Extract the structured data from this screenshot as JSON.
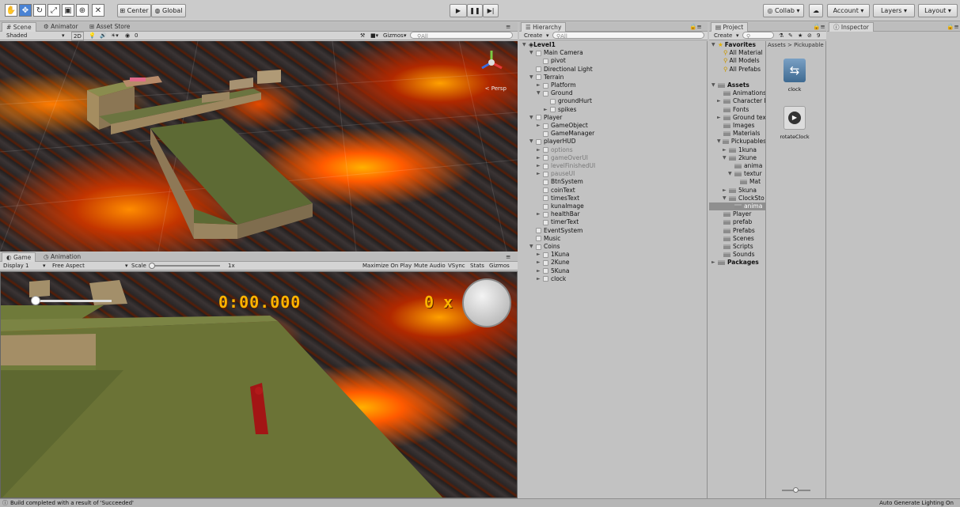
{
  "toolbar": {
    "center_label": "Center",
    "global_label": "Global",
    "collab_label": "Collab",
    "account_label": "Account",
    "layers_label": "Layers",
    "layout_label": "Layout"
  },
  "scene": {
    "tabs": [
      "Scene",
      "Animator",
      "Asset Store"
    ],
    "shaded": "Shaded",
    "two_d": "2D",
    "gizmos": "Gizmos",
    "search_placeholder": "All",
    "persp": "< Persp",
    "fx_count": "0"
  },
  "game": {
    "tabs": [
      "Game",
      "Animation"
    ],
    "display": "Display 1",
    "aspect": "Free Aspect",
    "scale_label": "Scale",
    "scale_value": "1x",
    "options": [
      "Maximize On Play",
      "Mute Audio",
      "VSync",
      "Stats",
      "Gizmos"
    ],
    "timer": "0:00.000",
    "coin_count": "0 x"
  },
  "hierarchy": {
    "title": "Hierarchy",
    "create": "Create",
    "search_placeholder": "All",
    "items": [
      {
        "label": "Level1",
        "depth": 0,
        "arrow": "▼",
        "kind": "scene"
      },
      {
        "label": "Main Camera",
        "depth": 1,
        "arrow": "▼",
        "kind": "go"
      },
      {
        "label": "pivot",
        "depth": 2,
        "arrow": "",
        "kind": "go"
      },
      {
        "label": "Directional Light",
        "depth": 1,
        "arrow": "",
        "kind": "go"
      },
      {
        "label": "Terrain",
        "depth": 1,
        "arrow": "▼",
        "kind": "go"
      },
      {
        "label": "Platform",
        "depth": 2,
        "arrow": "►",
        "kind": "go"
      },
      {
        "label": "Ground",
        "depth": 2,
        "arrow": "▼",
        "kind": "go"
      },
      {
        "label": "groundHurt",
        "depth": 3,
        "arrow": "",
        "kind": "go"
      },
      {
        "label": "spikes",
        "depth": 3,
        "arrow": "►",
        "kind": "go"
      },
      {
        "label": "Player",
        "depth": 1,
        "arrow": "▼",
        "kind": "go"
      },
      {
        "label": "GameObject",
        "depth": 2,
        "arrow": "►",
        "kind": "go"
      },
      {
        "label": "GameManager",
        "depth": 2,
        "arrow": "",
        "kind": "go"
      },
      {
        "label": "playerHUD",
        "depth": 1,
        "arrow": "▼",
        "kind": "go"
      },
      {
        "label": "options",
        "depth": 2,
        "arrow": "►",
        "kind": "dim"
      },
      {
        "label": "gameOverUI",
        "depth": 2,
        "arrow": "►",
        "kind": "dim"
      },
      {
        "label": "levelFinishedUI",
        "depth": 2,
        "arrow": "►",
        "kind": "dim"
      },
      {
        "label": "pauseUI",
        "depth": 2,
        "arrow": "►",
        "kind": "dim"
      },
      {
        "label": "BtnSystem",
        "depth": 2,
        "arrow": "",
        "kind": "go"
      },
      {
        "label": "coinText",
        "depth": 2,
        "arrow": "",
        "kind": "go"
      },
      {
        "label": "timesText",
        "depth": 2,
        "arrow": "",
        "kind": "go"
      },
      {
        "label": "kunaImage",
        "depth": 2,
        "arrow": "",
        "kind": "go"
      },
      {
        "label": "healthBar",
        "depth": 2,
        "arrow": "►",
        "kind": "go"
      },
      {
        "label": "timerText",
        "depth": 2,
        "arrow": "",
        "kind": "go"
      },
      {
        "label": "EventSystem",
        "depth": 1,
        "arrow": "",
        "kind": "go"
      },
      {
        "label": "Music",
        "depth": 1,
        "arrow": "",
        "kind": "go"
      },
      {
        "label": "Coins",
        "depth": 1,
        "arrow": "▼",
        "kind": "go"
      },
      {
        "label": "1Kuna",
        "depth": 2,
        "arrow": "►",
        "kind": "go"
      },
      {
        "label": "2Kune",
        "depth": 2,
        "arrow": "►",
        "kind": "go"
      },
      {
        "label": "5Kuna",
        "depth": 2,
        "arrow": "►",
        "kind": "go"
      },
      {
        "label": "clock",
        "depth": 2,
        "arrow": "►",
        "kind": "go"
      }
    ]
  },
  "project": {
    "title": "Project",
    "create": "Create",
    "breadcrumb": "Assets > Pickupable",
    "tree": [
      {
        "label": "Favorites",
        "depth": 0,
        "arrow": "▼",
        "bold": true,
        "kind": "star"
      },
      {
        "label": "All Material",
        "depth": 1,
        "arrow": "",
        "kind": "search"
      },
      {
        "label": "All Models",
        "depth": 1,
        "arrow": "",
        "kind": "search"
      },
      {
        "label": "All Prefabs",
        "depth": 1,
        "arrow": "",
        "kind": "search"
      },
      {
        "label": "",
        "depth": 0,
        "arrow": "",
        "kind": "spacer"
      },
      {
        "label": "Assets",
        "depth": 0,
        "arrow": "▼",
        "bold": true,
        "kind": "folder"
      },
      {
        "label": "Animations",
        "depth": 1,
        "arrow": "",
        "kind": "folder"
      },
      {
        "label": "Character I",
        "depth": 1,
        "arrow": "►",
        "kind": "folder"
      },
      {
        "label": "Fonts",
        "depth": 1,
        "arrow": "",
        "kind": "folder"
      },
      {
        "label": "Ground tex",
        "depth": 1,
        "arrow": "►",
        "kind": "folder"
      },
      {
        "label": "Images",
        "depth": 1,
        "arrow": "",
        "kind": "folder"
      },
      {
        "label": "Materials",
        "depth": 1,
        "arrow": "",
        "kind": "folder"
      },
      {
        "label": "Pickupables",
        "depth": 1,
        "arrow": "▼",
        "kind": "folder"
      },
      {
        "label": "1kuna",
        "depth": 2,
        "arrow": "►",
        "kind": "folder"
      },
      {
        "label": "2kune",
        "depth": 2,
        "arrow": "▼",
        "kind": "folder"
      },
      {
        "label": "anima",
        "depth": 3,
        "arrow": "",
        "kind": "folder"
      },
      {
        "label": "textur",
        "depth": 3,
        "arrow": "▼",
        "kind": "folder"
      },
      {
        "label": "Mat",
        "depth": 4,
        "arrow": "",
        "kind": "folder"
      },
      {
        "label": "5kuna",
        "depth": 2,
        "arrow": "►",
        "kind": "folder"
      },
      {
        "label": "ClockSto",
        "depth": 2,
        "arrow": "▼",
        "kind": "folder"
      },
      {
        "label": "anima",
        "depth": 3,
        "arrow": "",
        "kind": "folder",
        "selected": true
      },
      {
        "label": "Player",
        "depth": 1,
        "arrow": "",
        "kind": "folder"
      },
      {
        "label": "prefab",
        "depth": 1,
        "arrow": "",
        "kind": "folder"
      },
      {
        "label": "Prefabs",
        "depth": 1,
        "arrow": "",
        "kind": "folder"
      },
      {
        "label": "Scenes",
        "depth": 1,
        "arrow": "",
        "kind": "folder"
      },
      {
        "label": "Scripts",
        "depth": 1,
        "arrow": "",
        "kind": "folder"
      },
      {
        "label": "Sounds",
        "depth": 1,
        "arrow": "",
        "kind": "folder"
      },
      {
        "label": "Packages",
        "depth": 0,
        "arrow": "►",
        "bold": true,
        "kind": "folder"
      }
    ],
    "assets": [
      {
        "label": "clock",
        "icon": "animator-controller-icon"
      },
      {
        "label": "rotateClock",
        "icon": "animation-clip-icon"
      }
    ],
    "filter_count": "9"
  },
  "inspector": {
    "title": "Inspector"
  },
  "status": {
    "message": "Build completed with a result of 'Succeeded'",
    "lighting": "Auto Generate Lighting On"
  }
}
